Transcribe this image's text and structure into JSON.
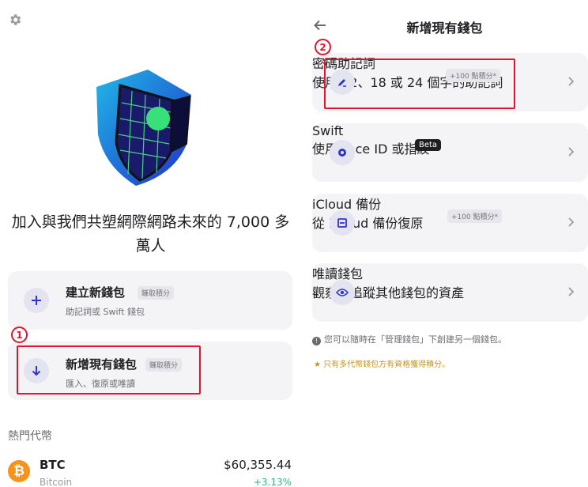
{
  "left": {
    "hero_text": "加入與我們共塑網際網路未來的 7,000 多萬人",
    "create_card": {
      "title": "建立新錢包",
      "badge": "賺取積分",
      "subtitle": "助記詞或 Swift 錢包"
    },
    "import_card": {
      "title": "新增現有錢包",
      "badge": "賺取積分",
      "subtitle": "匯入、復原或唯讀"
    },
    "marker": "1",
    "section_title": "熱門代幣",
    "coin": {
      "logo_glyph": "₿",
      "symbol": "BTC",
      "name": "Bitcoin",
      "price": "$60,355.44",
      "change": "+3.13%"
    }
  },
  "right": {
    "title": "新增現有錢包",
    "marker": "2",
    "options": [
      {
        "title": "密碼助記詞",
        "badge": "+100 點積分*",
        "subtitle": "使用 12、18 或 24 個字的助記詞",
        "icon": "pen-icon"
      },
      {
        "title": "Swift",
        "badge": "Beta",
        "subtitle": "使用 Face ID 或指紋",
        "icon": "swift-gear-icon"
      },
      {
        "title": "iCloud 備份",
        "badge": "+100 點積分*",
        "subtitle": "從 iCloud 備份復原",
        "icon": "cloud-backup-icon"
      },
      {
        "title": "唯讀錢包",
        "badge": "",
        "subtitle": "觀察或追蹤其他錢包的資產",
        "icon": "eye-icon"
      }
    ],
    "info_text": "您可以隨時在「管理錢包」下創建另一個錢包。",
    "info_glyph": "!",
    "note_text": "★ 只有多代幣錢包方有資格獲得積分。"
  },
  "colors": {
    "accent": "#2f35c9",
    "highlight": "#e0142f",
    "positive": "#2eb67d",
    "card_bg": "#f4f4f6"
  }
}
